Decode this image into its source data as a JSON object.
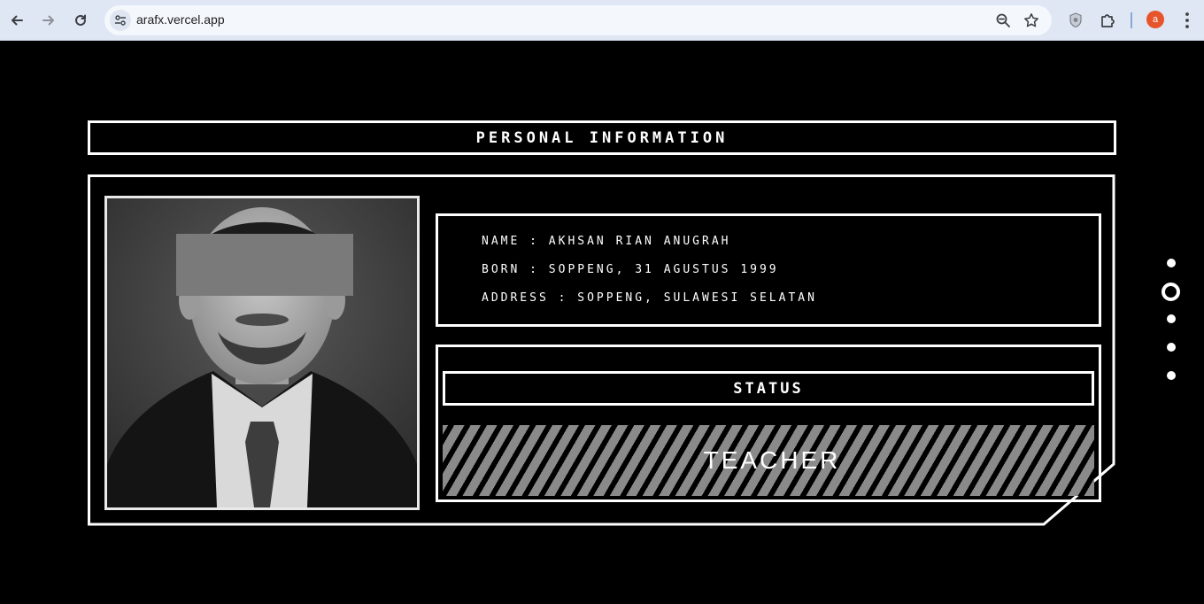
{
  "browser": {
    "url": "arafx.vercel.app",
    "profile_initial": "a",
    "profile_color": "#e8542a",
    "icons": [
      "back-icon",
      "forward-icon",
      "reload-icon",
      "site-info-icon",
      "zoom-icon",
      "bookmark-star-icon",
      "shield-extension-icon",
      "puzzle-extensions-icon",
      "more-menu-icon"
    ]
  },
  "page": {
    "title": "PERSONAL INFORMATION",
    "info": {
      "name": "NAME : AKHSAN RIAN ANUGRAH",
      "born": "BORN : SOPPENG, 31 AGUSTUS 1999",
      "address": "ADDRESS : SOPPENG, SULAWESI SELATAN"
    },
    "status": {
      "label": "STATUS",
      "value": "TEACHER"
    },
    "section_dots": {
      "count": 5,
      "active_index": 1
    }
  },
  "colors": {
    "background": "#000000",
    "foreground": "#ffffff",
    "stripe": "#8a8a8a"
  }
}
